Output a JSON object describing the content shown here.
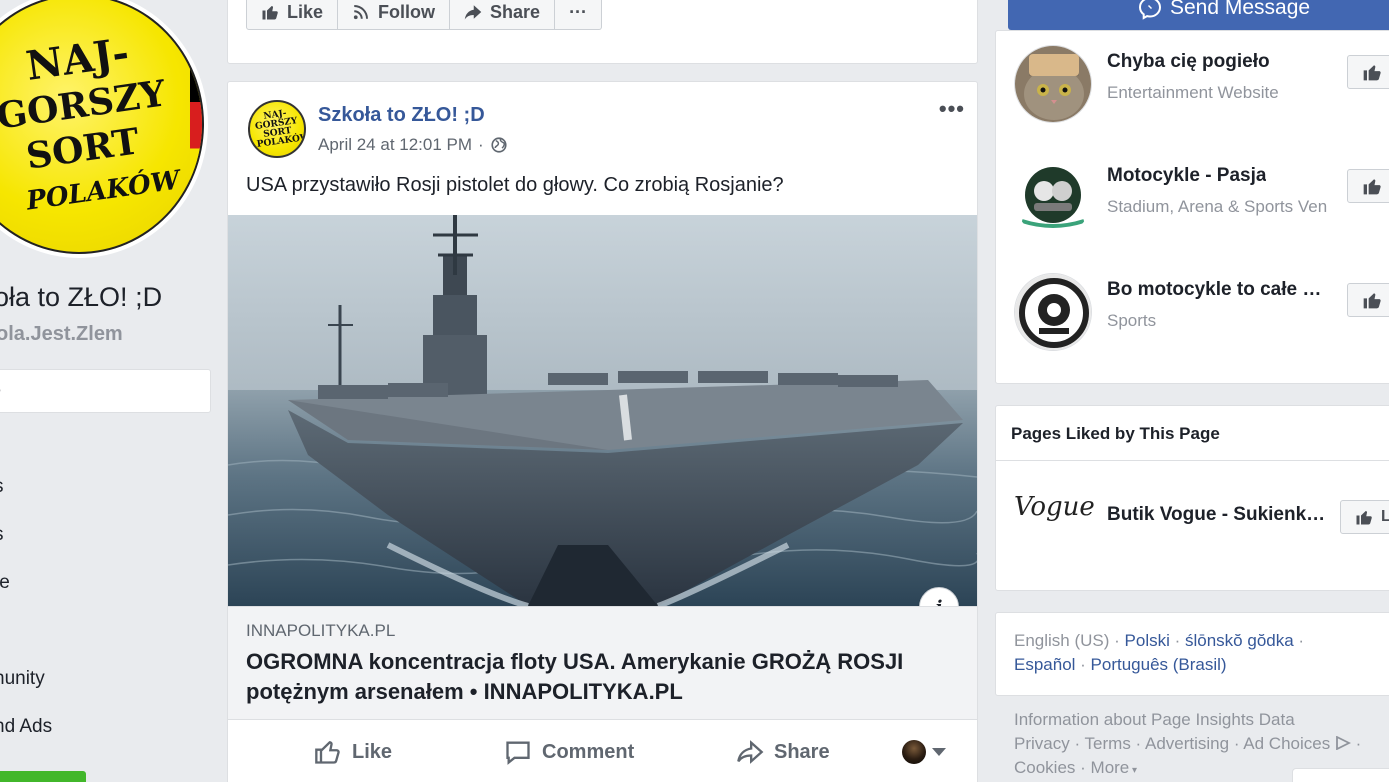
{
  "colors": {
    "fb_blue": "#4267b2",
    "link_blue": "#365899",
    "bg": "#e9ebee",
    "green": "#42b72a",
    "logo_yellow": "#f6e600"
  },
  "left": {
    "logo_lines": [
      "NAJ-",
      "GORSZY",
      "SORT",
      "POLAKÓW"
    ],
    "page_name": "oła to ZŁO! ;D",
    "page_username": "ola.Jest.Zlem",
    "nav_active": "e",
    "nav_items": [
      "",
      "s",
      "s",
      "te",
      "",
      "nunity",
      "nd Ads"
    ]
  },
  "top_actions": {
    "like": "Like",
    "follow": "Follow",
    "share": "Share",
    "more": "···"
  },
  "post": {
    "avatar_text": "NAJ-GORSZY SORT POLAKÓW",
    "author": "Szkoła to ZŁO! ;D",
    "timestamp": "April 24 at 12:01 PM",
    "separator": "·",
    "more": "•••",
    "text": "USA przystawiło Rosji pistolet do głowy. Co zrobią Rosjanie?",
    "info_icon": "i",
    "link_domain": "INNAPOLITYKA.PL",
    "link_title": "OGROMNA koncentracja floty USA. Amerykanie GROŻĄ ROSJI potężnym arsenałem • INNAPOLITYKA.PL",
    "actions": {
      "like": "Like",
      "comment": "Comment",
      "share": "Share"
    }
  },
  "right": {
    "send_message": "Send Message",
    "suggestions": [
      {
        "name": "Chyba cię pogieło",
        "category": "Entertainment Website"
      },
      {
        "name": "Motocykle - Pasja",
        "category": "Stadium, Arena & Sports Ven"
      },
      {
        "name": "Bo motocykle to całe …",
        "category": "Sports"
      }
    ],
    "liked_heading": "Pages Liked by This Page",
    "liked_page": {
      "name": "Butik Vogue - Sukienk…",
      "logo_text": "Vogue",
      "like_partial": "L"
    },
    "languages": {
      "english": "English (US)",
      "polski": "Polski",
      "silesian": "ślōnskŏ gŏdka",
      "espanol": "Español",
      "portugues": "Português (Brasil)"
    },
    "footer": {
      "insights": "Information about Page Insights Data",
      "privacy": "Privacy",
      "terms": "Terms",
      "advertising": "Advertising",
      "ad_choices": "Ad Choices",
      "cookies": "Cookies",
      "more": "More"
    }
  }
}
